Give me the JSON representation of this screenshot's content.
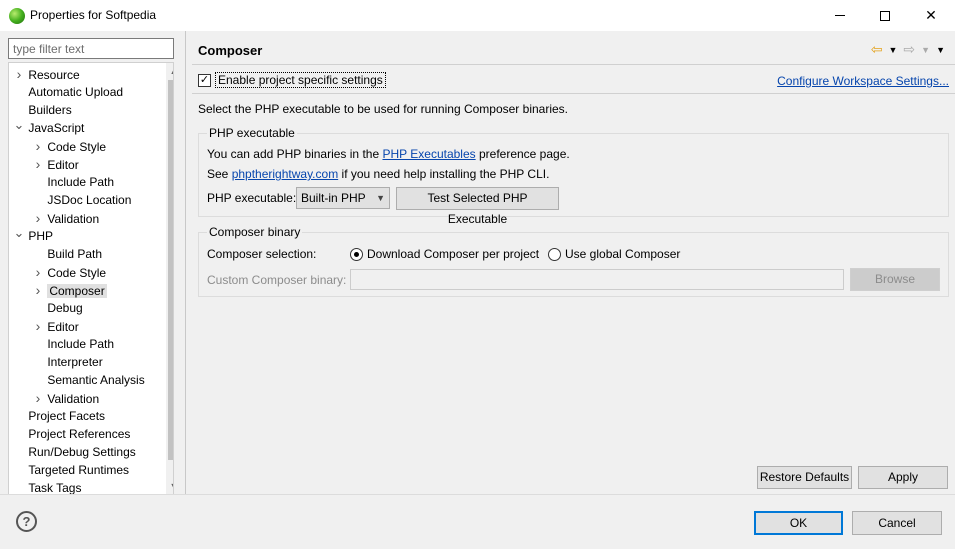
{
  "window": {
    "title": "Properties for Softpedia"
  },
  "sidebar": {
    "filter_placeholder": "type filter text",
    "items": [
      {
        "label": "Resource",
        "level": 0,
        "expander": "collapsed",
        "selected": false
      },
      {
        "label": "Automatic Upload",
        "level": 0,
        "expander": "none",
        "selected": false
      },
      {
        "label": "Builders",
        "level": 0,
        "expander": "none",
        "selected": false
      },
      {
        "label": "JavaScript",
        "level": 0,
        "expander": "expanded",
        "selected": false
      },
      {
        "label": "Code Style",
        "level": 1,
        "expander": "collapsed",
        "selected": false
      },
      {
        "label": "Editor",
        "level": 1,
        "expander": "collapsed",
        "selected": false
      },
      {
        "label": "Include Path",
        "level": 1,
        "expander": "none",
        "selected": false
      },
      {
        "label": "JSDoc Location",
        "level": 1,
        "expander": "none",
        "selected": false
      },
      {
        "label": "Validation",
        "level": 1,
        "expander": "collapsed",
        "selected": false
      },
      {
        "label": "PHP",
        "level": 0,
        "expander": "expanded",
        "selected": false
      },
      {
        "label": "Build Path",
        "level": 1,
        "expander": "none",
        "selected": false
      },
      {
        "label": "Code Style",
        "level": 1,
        "expander": "collapsed",
        "selected": false
      },
      {
        "label": "Composer",
        "level": 1,
        "expander": "collapsed",
        "selected": true
      },
      {
        "label": "Debug",
        "level": 1,
        "expander": "none",
        "selected": false
      },
      {
        "label": "Editor",
        "level": 1,
        "expander": "collapsed",
        "selected": false
      },
      {
        "label": "Include Path",
        "level": 1,
        "expander": "none",
        "selected": false
      },
      {
        "label": "Interpreter",
        "level": 1,
        "expander": "none",
        "selected": false
      },
      {
        "label": "Semantic Analysis",
        "level": 1,
        "expander": "none",
        "selected": false
      },
      {
        "label": "Validation",
        "level": 1,
        "expander": "collapsed",
        "selected": false
      },
      {
        "label": "Project Facets",
        "level": 0,
        "expander": "none",
        "selected": false
      },
      {
        "label": "Project References",
        "level": 0,
        "expander": "none",
        "selected": false
      },
      {
        "label": "Run/Debug Settings",
        "level": 0,
        "expander": "none",
        "selected": false
      },
      {
        "label": "Targeted Runtimes",
        "level": 0,
        "expander": "none",
        "selected": false
      },
      {
        "label": "Task Tags",
        "level": 0,
        "expander": "none",
        "selected": false
      }
    ]
  },
  "page": {
    "title": "Composer",
    "enable_label": "Enable project specific settings",
    "enable_checked": true,
    "config_link": "Configure Workspace Settings...",
    "description": "Select the PHP executable to be used for running Composer binaries."
  },
  "php_group": {
    "title": "PHP executable",
    "line1_pre": "You can add PHP binaries in the ",
    "line1_link": "PHP Executables",
    "line1_post": " preference page.",
    "line2_pre": "See ",
    "line2_link": "phptherightway.com",
    "line2_post": " if you need help installing the PHP CLI.",
    "exe_label": "PHP executable:",
    "exe_value": "Built-in PHP",
    "test_button": "Test Selected PHP Executable"
  },
  "composer_group": {
    "title": "Composer binary",
    "selection_label": "Composer selection:",
    "option_download": "Download Composer per project",
    "option_global": "Use global Composer",
    "selected_option": "download",
    "custom_label": "Custom Composer binary:",
    "browse_button": "Browse"
  },
  "buttons": {
    "restore": "Restore Defaults",
    "apply": "Apply",
    "ok": "OK",
    "cancel": "Cancel"
  },
  "icons": {
    "app": "eclipse-icon",
    "help": "help-icon",
    "back": "back-arrow-icon",
    "forward": "forward-arrow-icon"
  }
}
